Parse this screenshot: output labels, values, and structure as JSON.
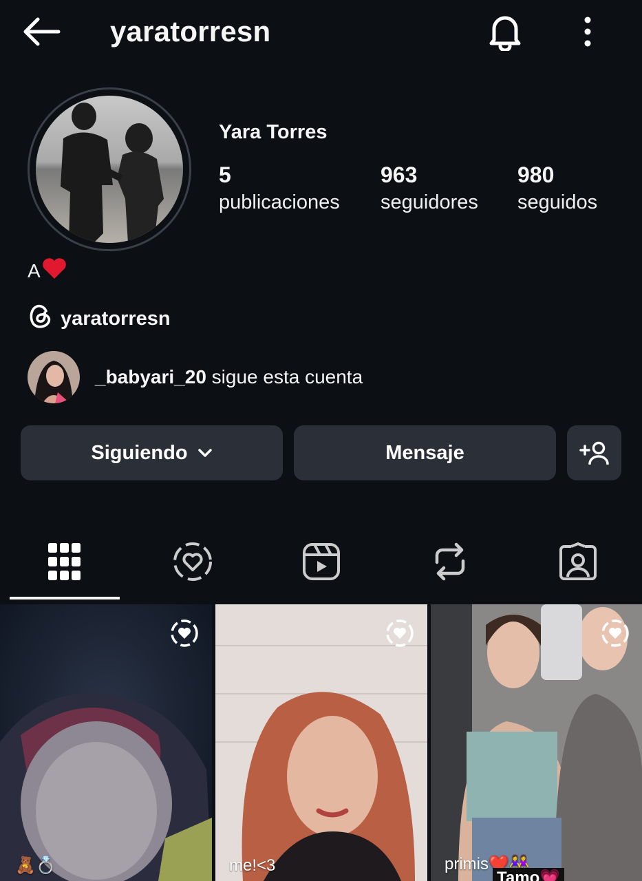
{
  "header": {
    "username": "yaratorresn",
    "back_icon": "arrow-left-icon",
    "bell_icon": "bell-icon",
    "more_icon": "more-vertical-icon"
  },
  "profile": {
    "display_name": "Yara Torres",
    "stats": [
      {
        "value": "5",
        "label": "publicaciones"
      },
      {
        "value": "963",
        "label": "seguidores"
      },
      {
        "value": "980",
        "label": "seguidos"
      }
    ],
    "bio": "A",
    "bio_emoji": "❤️",
    "threads_handle": "yaratorresn",
    "followed_by": {
      "username": "_babyari_20",
      "text": " sigue esta cuenta"
    }
  },
  "actions": {
    "following_label": "Siguiendo",
    "message_label": "Mensaje",
    "add_person_icon": "add-person-icon"
  },
  "tabs": [
    {
      "name": "grid",
      "icon": "grid-icon",
      "active": true
    },
    {
      "name": "collabs",
      "icon": "heart-circle-icon",
      "active": false
    },
    {
      "name": "reels",
      "icon": "reels-icon",
      "active": false
    },
    {
      "name": "reposts",
      "icon": "repost-icon",
      "active": false
    },
    {
      "name": "tagged",
      "icon": "tagged-person-icon",
      "active": false
    }
  ],
  "posts": [
    {
      "caption": "🧸💍"
    },
    {
      "caption": "me!<3"
    },
    {
      "caption": "primis❤️👭",
      "sub_caption": "Tamo💗"
    }
  ],
  "colors": {
    "background": "#0c0f14",
    "button_bg": "#2a2f38",
    "text": "#f5f5f5"
  }
}
